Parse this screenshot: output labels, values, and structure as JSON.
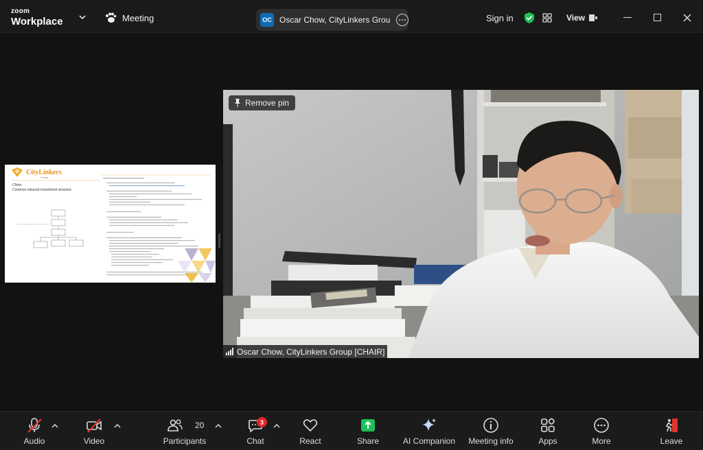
{
  "titlebar": {
    "brand_small": "zoom",
    "brand_big": "Workplace",
    "meeting_tab": "Meeting",
    "host_initials": "OC",
    "host_name": "Oscar Chow, CityLinkers Group [",
    "sign_in": "Sign in",
    "view": "View"
  },
  "stage": {
    "remove_pin": "Remove pin",
    "speaker_name": "Oscar Chow, CityLinkers Group [CHAIR]",
    "slide": {
      "logo_text": "CityLinkers",
      "logo_sub": "Group",
      "heading_1": "China",
      "heading_2": "Common inbound investment structure"
    }
  },
  "toolbar": {
    "audio": "Audio",
    "video": "Video",
    "participants": "Participants",
    "participants_count": "20",
    "chat": "Chat",
    "chat_badge": "3",
    "react": "React",
    "share": "Share",
    "ai_companion": "AI Companion",
    "meeting_info": "Meeting info",
    "apps": "Apps",
    "more": "More",
    "leave": "Leave"
  },
  "colors": {
    "share_green": "#1fbf5a",
    "leave_red": "#e5322d",
    "shield_green": "#1fbf5a",
    "avatar_blue": "#0e6bb8",
    "badge_red": "#e02828",
    "muted_red": "#e5322d"
  },
  "icons": {
    "audio": "microphone-muted-icon",
    "video": "camera-off-icon",
    "participants": "people-icon",
    "chat": "chat-bubble-icon",
    "react": "heart-icon",
    "share": "share-arrow-icon",
    "ai": "sparkle-icon",
    "info": "info-icon",
    "apps": "apps-icon",
    "more": "more-icon",
    "leave": "leave-door-icon"
  }
}
